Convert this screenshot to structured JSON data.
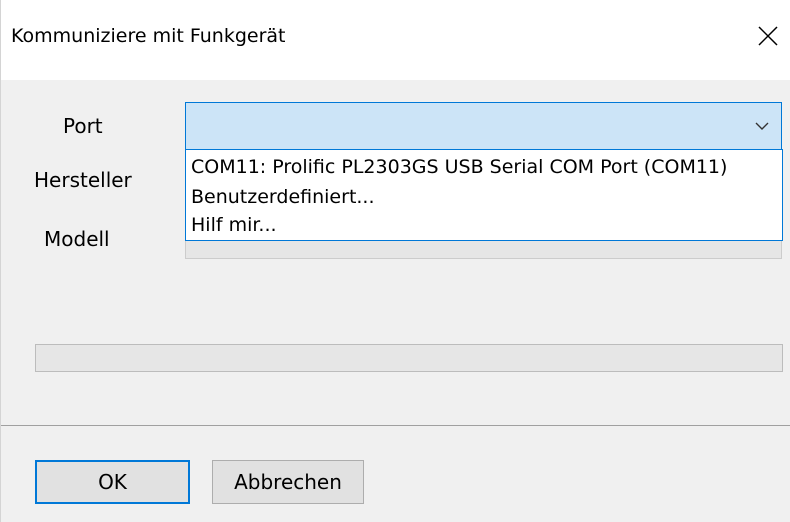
{
  "window": {
    "title": "Kommuniziere mit Funkgerät"
  },
  "form": {
    "port_label": "Port",
    "manufacturer_label": "Hersteller",
    "model_label": "Modell",
    "port_value": ""
  },
  "port_dropdown": {
    "options": [
      "COM11: Prolific PL2303GS USB Serial COM Port (COM11)",
      "Benutzerdefiniert...",
      "Hilf mir..."
    ]
  },
  "buttons": {
    "ok_label": "OK",
    "cancel_label": "Abbrechen"
  },
  "icons": {
    "close": "close-icon",
    "dropdown": "chevron-down-icon"
  },
  "colors": {
    "accent": "#0078d7",
    "combo_selected_bg": "#cce4f7",
    "dialog_bg": "#f0f0f0"
  }
}
